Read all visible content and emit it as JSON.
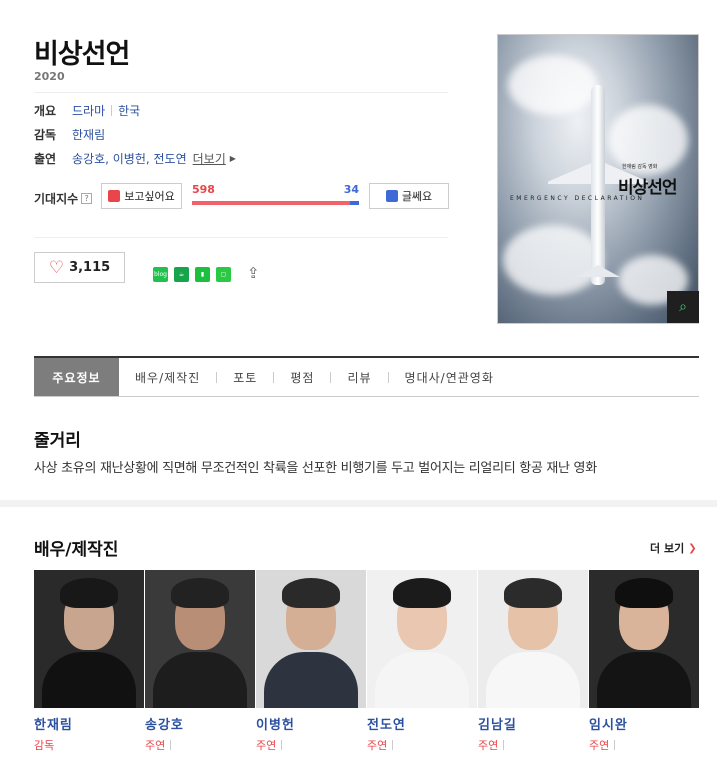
{
  "movie": {
    "title": "비상선언",
    "year": "2020",
    "genre": "드라마",
    "country": "한국",
    "director": "한재림",
    "cast": "송강호, 이병헌, 전도연",
    "more_label": "더보기"
  },
  "labels": {
    "overview": "개요",
    "director": "감독",
    "cast": "출연",
    "expectation": "기대지수",
    "question": "?"
  },
  "expectation": {
    "want_label": "보고싶어요",
    "no_label": "글쎄요",
    "want_count": "598",
    "no_count": "34",
    "want_ratio": 0.946
  },
  "like": {
    "count": "3,115"
  },
  "share": {
    "icons": [
      "blog-share-icon",
      "cafe-share-icon",
      "band-share-icon",
      "line-share-icon",
      "share-arrow-icon"
    ],
    "blog_text": "blog"
  },
  "poster": {
    "title": "비상선언",
    "subtitle": "한재림 감독 영화",
    "english": "EMERGENCY DECLARATION"
  },
  "tabs": [
    "주요정보",
    "배우/제작진",
    "포토",
    "평점",
    "리뷰",
    "명대사/연관영화"
  ],
  "synopsis": {
    "heading": "줄거리",
    "text": "사상 초유의 재난상황에 직면해 무조건적인 착륙을 선포한 비행기를 두고 벌어지는 리얼리티 항공 재난 영화"
  },
  "cast_section": {
    "heading": "배우/제작진",
    "more": "더 보기",
    "people": [
      {
        "name": "한재림",
        "role": "감독"
      },
      {
        "name": "송강호",
        "role": "주연"
      },
      {
        "name": "이병헌",
        "role": "주연"
      },
      {
        "name": "전도연",
        "role": "주연"
      },
      {
        "name": "김남길",
        "role": "주연"
      },
      {
        "name": "임시완",
        "role": "주연"
      }
    ]
  },
  "colors": {
    "accent_red": "#e8464a",
    "accent_blue": "#3d6ad6",
    "link_blue": "#2c50a0",
    "tab_active": "#7d7d7d"
  }
}
